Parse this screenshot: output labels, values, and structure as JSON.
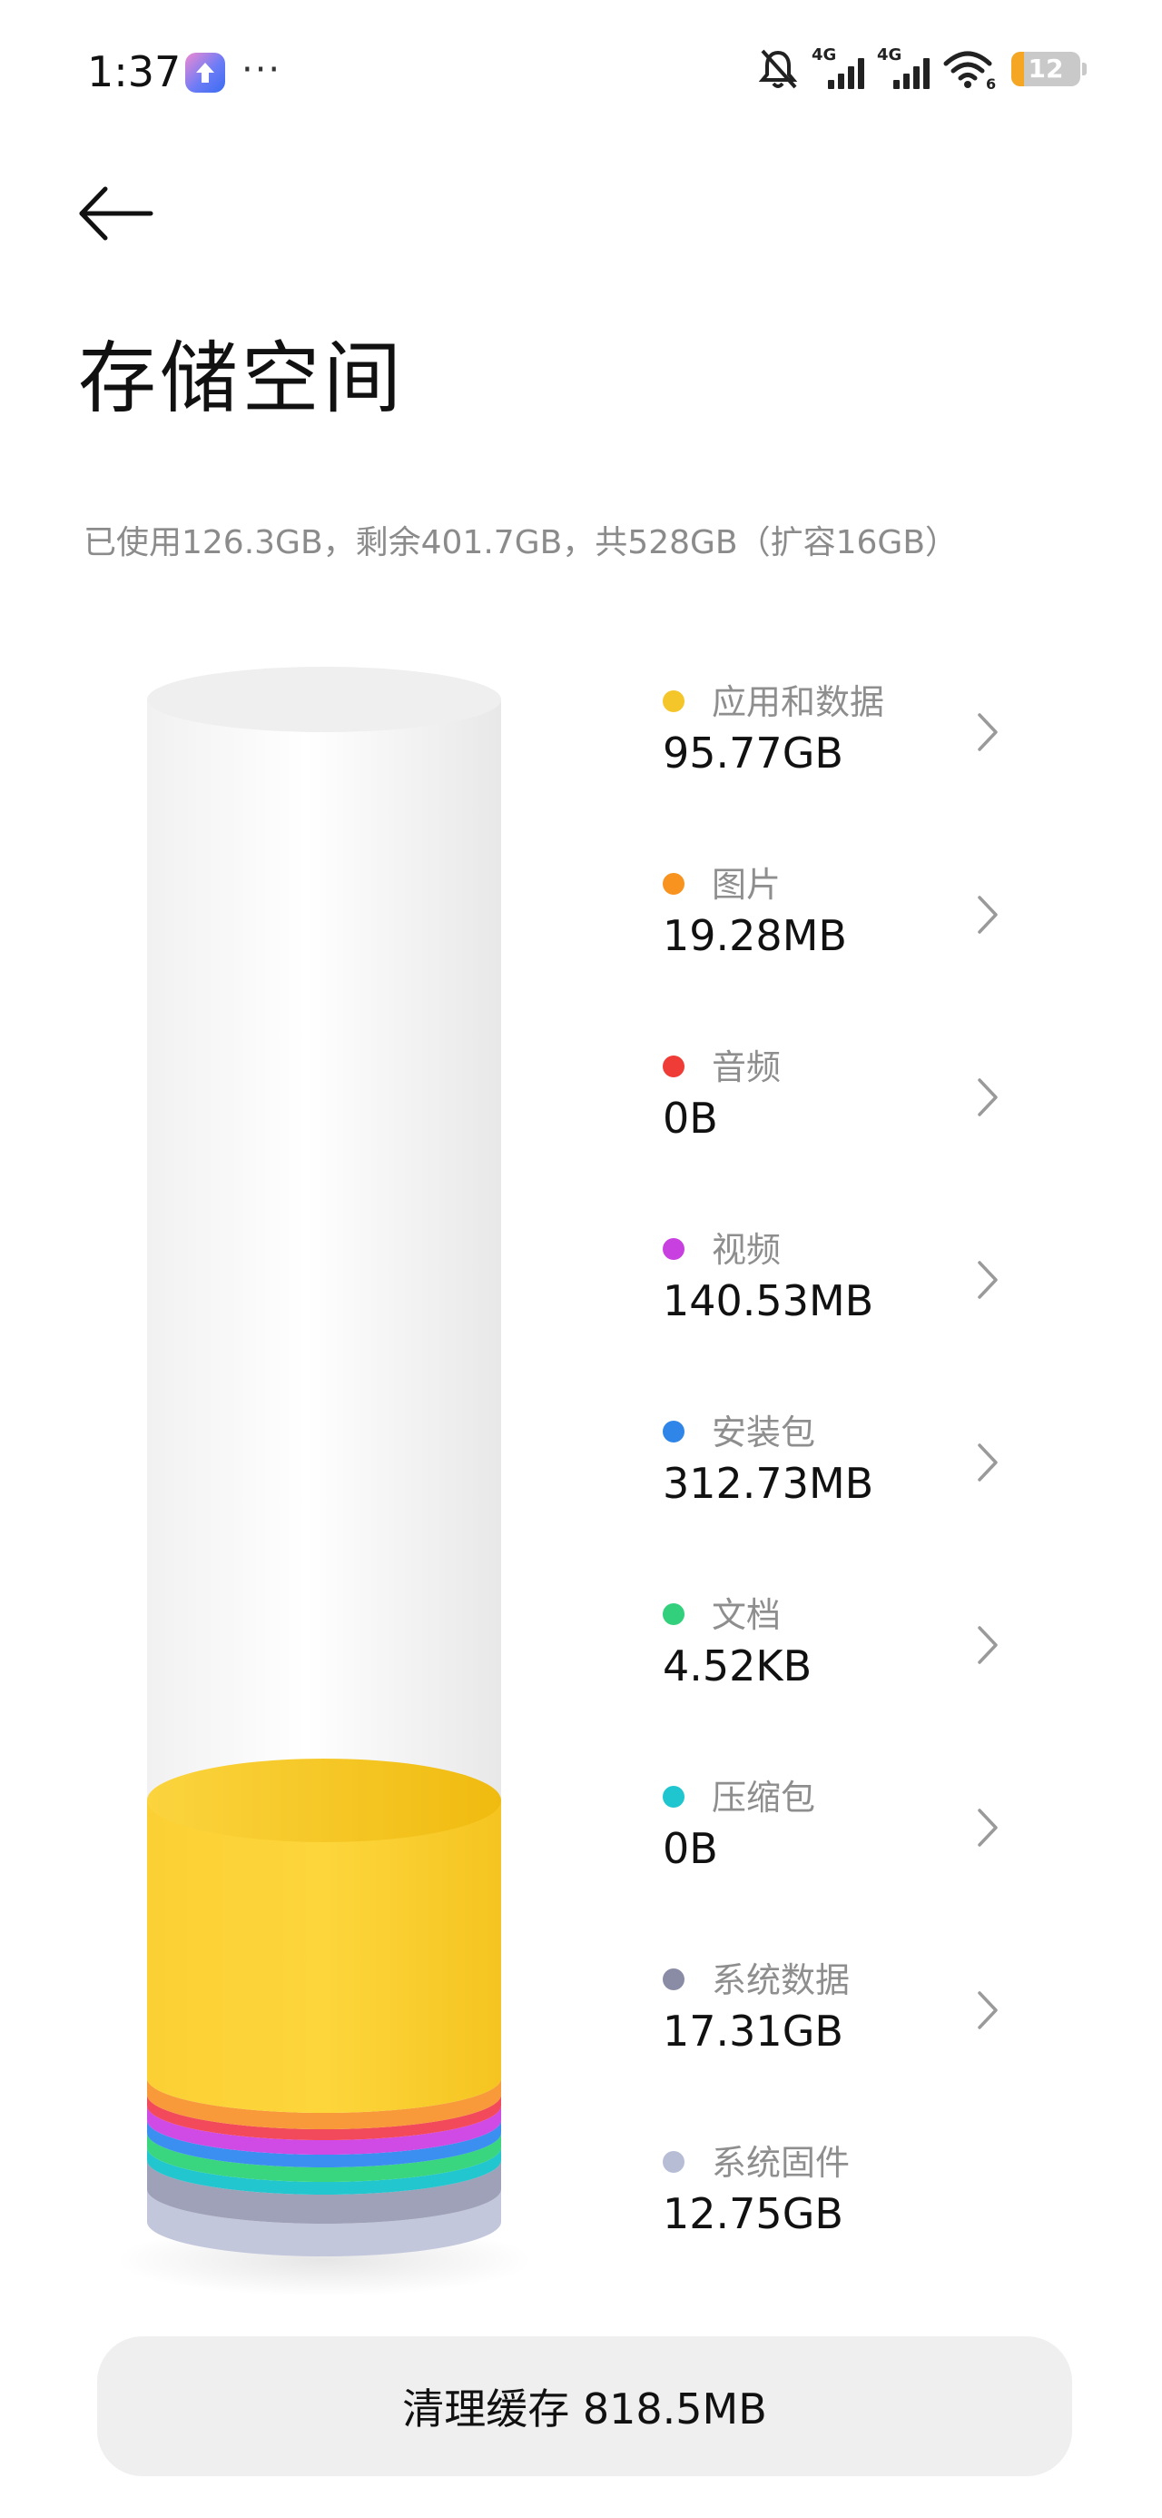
{
  "status_bar": {
    "time": "1:37",
    "more": "···",
    "sim1_label": "4G",
    "sim2_label": "4G",
    "wifi_sub": "6",
    "battery": "12"
  },
  "page": {
    "title": "存储空间",
    "summary": "已使用126.3GB，剩余401.7GB，共528GB（扩容16GB）"
  },
  "legend": [
    {
      "label": "应用和数据",
      "value": "95.77GB",
      "color": "#F5C62A",
      "has_chevron": true
    },
    {
      "label": "图片",
      "value": "19.28MB",
      "color": "#F7931E",
      "has_chevron": true
    },
    {
      "label": "音频",
      "value": "0B",
      "color": "#F03C36",
      "has_chevron": true
    },
    {
      "label": "视频",
      "value": "140.53MB",
      "color": "#C840E0",
      "has_chevron": true
    },
    {
      "label": "安装包",
      "value": "312.73MB",
      "color": "#2F86E8",
      "has_chevron": true
    },
    {
      "label": "文档",
      "value": "4.52KB",
      "color": "#32D07C",
      "has_chevron": true
    },
    {
      "label": "压缩包",
      "value": "0B",
      "color": "#1FC6CF",
      "has_chevron": true
    },
    {
      "label": "系统数据",
      "value": "17.31GB",
      "color": "#8A8CA6",
      "has_chevron": true
    },
    {
      "label": "系统固件",
      "value": "12.75GB",
      "color": "#B8BDD6",
      "has_chevron": false
    }
  ],
  "clean_button": {
    "label": "清理缓存 818.5MB"
  }
}
